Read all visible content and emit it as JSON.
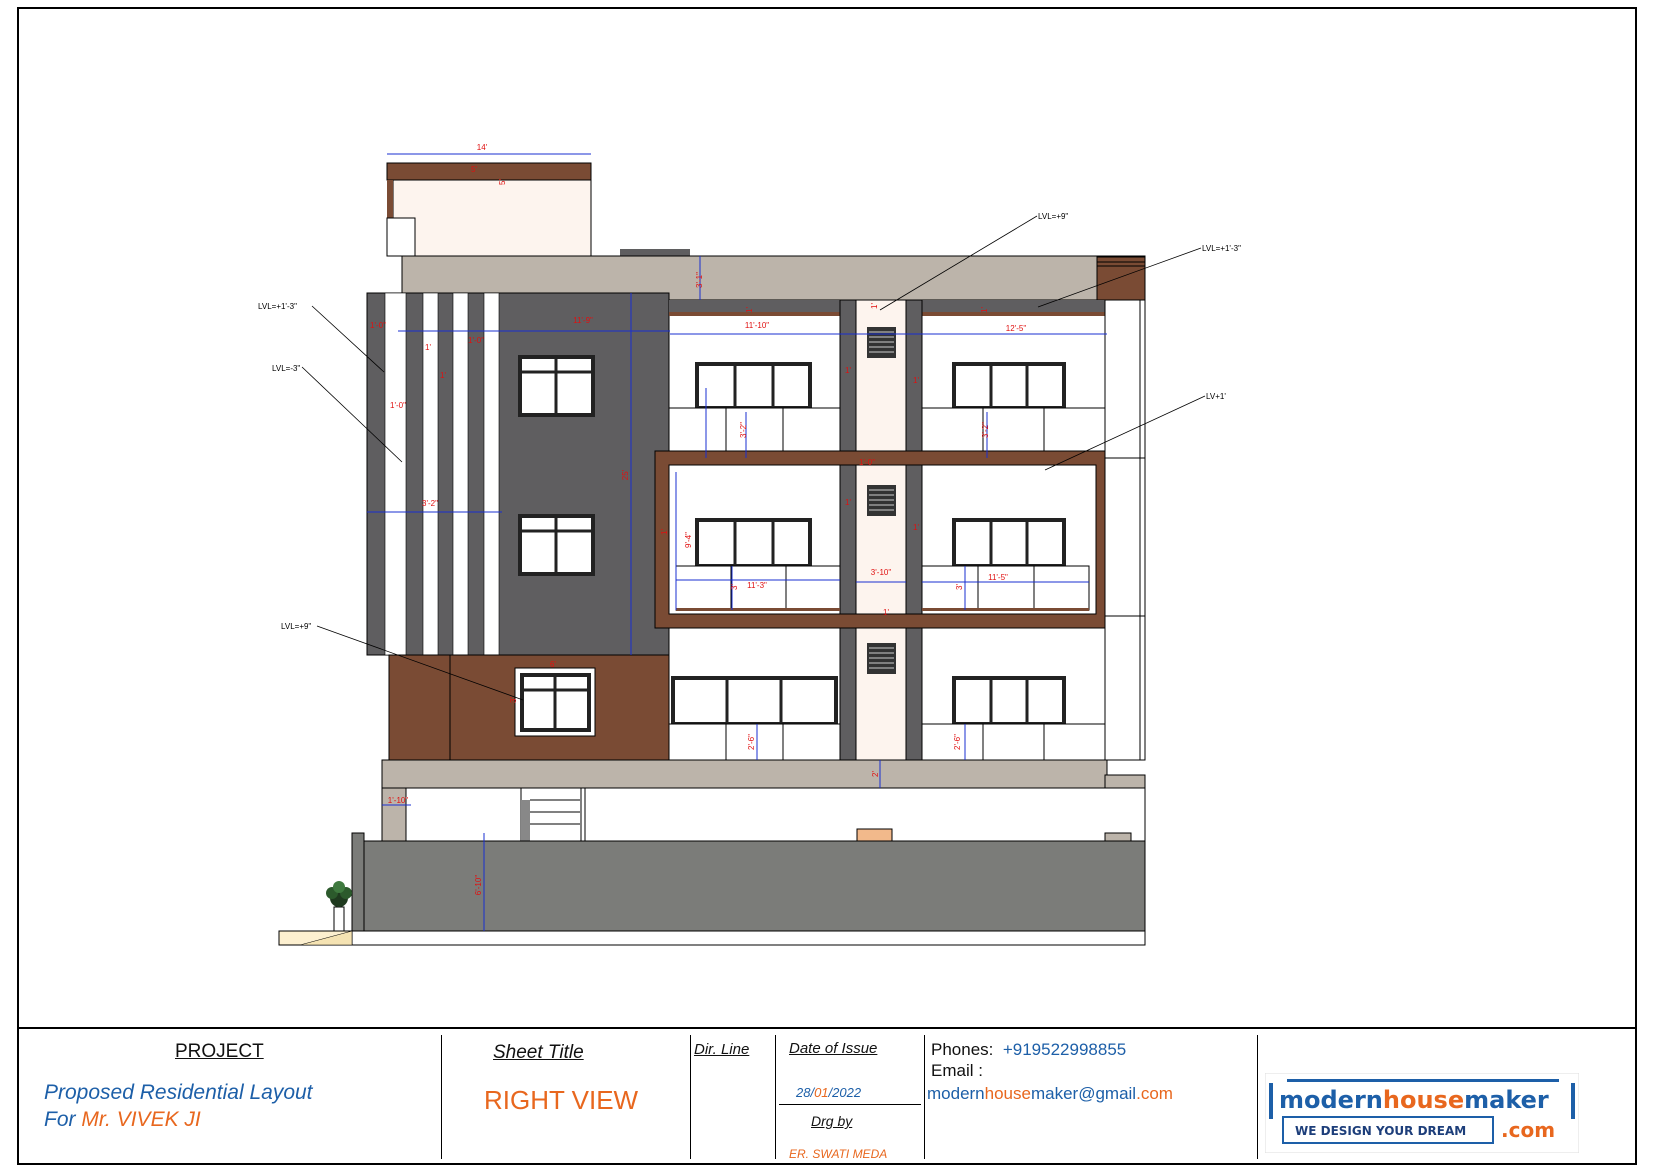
{
  "drawing": {
    "dimensions": [
      "14'",
      "5'",
      "5'",
      "3'-1\"",
      "1'",
      "1'",
      "11'-10\"",
      "12'-5\"",
      "1'-0\"",
      "1'",
      "1'-0\"",
      "1'-0\"",
      "1'",
      "11'-9\"",
      "1'",
      "1'",
      "3'-2\"",
      "3'-2\"",
      "1'",
      "25'",
      "1'-0\"",
      "9'-4\"",
      "1'",
      "1'",
      "1'",
      "3'-2\"",
      "3'-10\"",
      "11'-3\"",
      "11'-5\"",
      "3'",
      "3'",
      "1'",
      "6'",
      "3'",
      "2'-6\"",
      "2'-6\"",
      "2'",
      "1'-10\"",
      "6'-10\""
    ],
    "levels": [
      "LVL=+9\"",
      "LVL=+1'-3\"",
      "LVL=+1'-3\"",
      "LVL=-3\"",
      "LV+1'",
      "LVL=+9\""
    ]
  },
  "title_block": {
    "project_heading": "PROJECT",
    "project_line1": "Proposed Residential Layout",
    "project_for": "For",
    "client_name": "Mr. VIVEK  JI",
    "sheet_heading": "Sheet Title",
    "sheet_title": "RIGHT VIEW",
    "dir_line_heading": "Dir. Line",
    "date_heading": "Date of Issue",
    "date_day": "28/",
    "date_month": "01",
    "date_year": "/2022",
    "drg_by_heading": "Drg by",
    "drg_by_name": "ER. SWATI MEDA",
    "phones_label": "Phones:",
    "phone": "+919522998855",
    "email_label": "Email :",
    "email_part1": "modern",
    "email_part2": "house",
    "email_part3": "maker",
    "email_part4": "@gmail",
    "email_part5": ".com",
    "logo_modern": "modern",
    "logo_house": "house",
    "logo_maker": "maker",
    "logo_tagline": "WE DESIGN YOUR DREAM",
    "logo_com": ".com"
  },
  "colors": {
    "brown": "#7a4b34",
    "dark_grey": "#5f5e60",
    "taupe": "#bcb4aa",
    "cream": "#fdf4ee",
    "plinth": "#7b7c79",
    "brand_blue": "#1d5fa8",
    "brand_orange": "#e8671e",
    "dimension_red": "#e01010",
    "dimension_blue": "#1a2fd0"
  }
}
